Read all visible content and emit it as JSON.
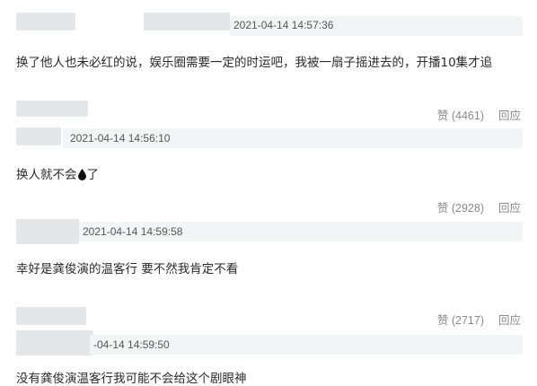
{
  "comments": [
    {
      "timestamp": "2021-04-14 14:57:36",
      "text": "换了他人也未必红的说，娱乐圈需要一定的时运吧，我被一扇子摇进去的，开播10集才追",
      "likes_label": "赞 (4461)",
      "reply_label": "回应"
    },
    {
      "timestamp": "2021-04-14 14:56:10",
      "text_before": "换人就不会",
      "emoji": "drop-icon",
      "text_after": "了",
      "likes_label": "赞 (2928)",
      "reply_label": "回应"
    },
    {
      "timestamp": "2021-04-14 14:59:58",
      "text": "幸好是龚俊演的温客行 要不然我肯定不看",
      "likes_label": "赞 (2717)",
      "reply_label": "回应"
    },
    {
      "timestamp": "-04-14 14:59:50",
      "text": "没有龚俊演温客行我可能不会给这个剧眼神"
    }
  ],
  "colors": {
    "timestamp_bar": "#f3f4f6",
    "redacted": "#e3e7ea",
    "action_text": "#8a8a8a"
  }
}
